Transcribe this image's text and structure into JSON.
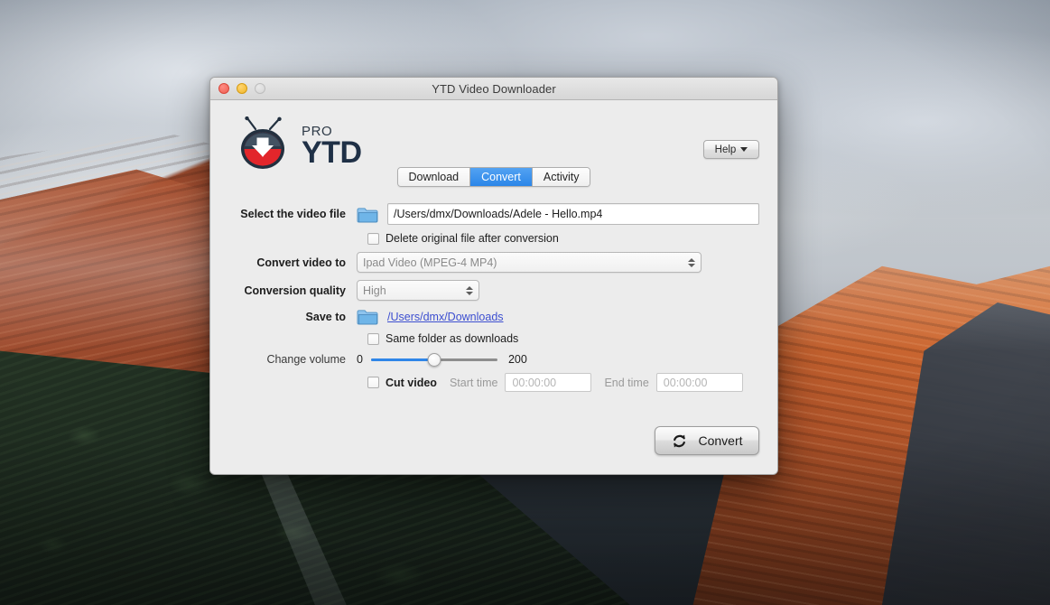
{
  "window": {
    "title": "YTD Video Downloader",
    "traffic_lights": [
      "close-button",
      "minimize-button",
      "zoom-button"
    ]
  },
  "branding": {
    "pro_label": "PRO",
    "name": "YTD",
    "logo_icon": "ytd-tv-download-logo"
  },
  "header": {
    "help_label": "Help",
    "help_caret_icon": "caret-down-icon"
  },
  "tabs": [
    {
      "label": "Download",
      "active": false
    },
    {
      "label": "Convert",
      "active": true
    },
    {
      "label": "Activity",
      "active": false
    }
  ],
  "form": {
    "select_file": {
      "label": "Select the video file",
      "folder_icon": "folder-icon",
      "value": "/Users/dmx/Downloads/Adele - Hello.mp4"
    },
    "delete_original": {
      "label": "Delete original file after conversion",
      "checked": false
    },
    "convert_to": {
      "label": "Convert video to",
      "value": "Ipad Video (MPEG-4 MP4)",
      "stepper_icon": "stepper-up-down-icon"
    },
    "quality": {
      "label": "Conversion quality",
      "value": "High",
      "stepper_icon": "stepper-up-down-icon"
    },
    "save_to": {
      "label": "Save to",
      "folder_icon": "folder-icon",
      "path": "/Users/dmx/Downloads"
    },
    "same_folder": {
      "label": "Same folder as downloads",
      "checked": false
    },
    "volume": {
      "label": "Change volume",
      "min": "0",
      "max": "200",
      "percent": 50
    },
    "cut_video": {
      "label": "Cut video",
      "checked": false,
      "start_label": "Start time",
      "start_value": "00:00:00",
      "end_label": "End time",
      "end_value": "00:00:00"
    }
  },
  "actions": {
    "convert_label": "Convert",
    "convert_icon": "convert-arrows-icon"
  },
  "colors": {
    "accent_blue": "#2b86e8",
    "link_blue": "#3d4fd0",
    "window_bg": "#ececec",
    "logo_red": "#e2262b",
    "logo_dark": "#22303f"
  }
}
